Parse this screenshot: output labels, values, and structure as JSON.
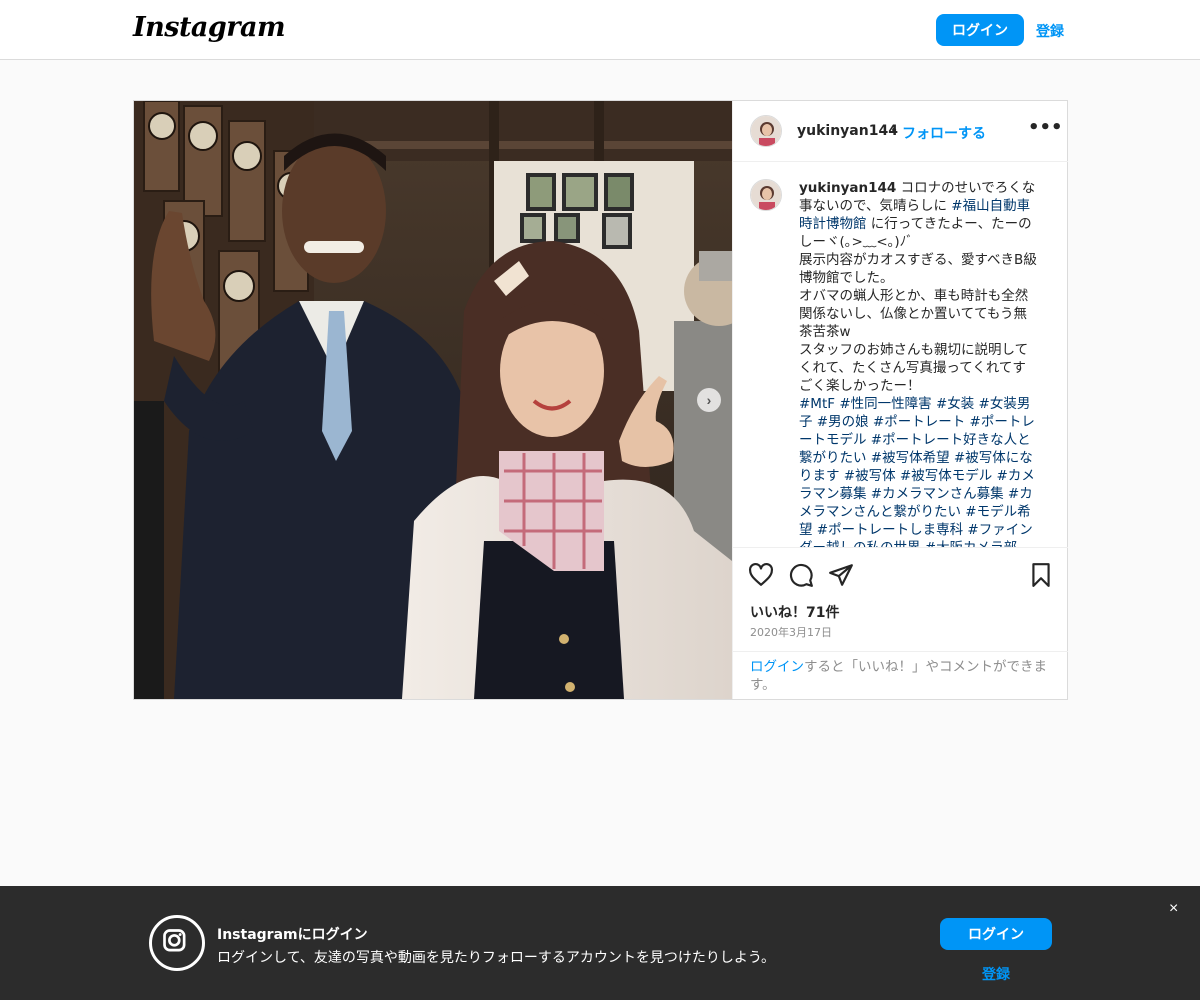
{
  "nav": {
    "logo": "Instagram",
    "login_label": "ログイン",
    "signup_label": "登録"
  },
  "post": {
    "username": "yukinyan144",
    "separator": "•",
    "follow_label": "フォローする",
    "more_label": "•••",
    "next_label": "›",
    "caption": {
      "username": "yukinyan144",
      "segments": [
        {
          "text": " コロナのせいでろくな事ないので、気晴らしに ",
          "tag": false
        },
        {
          "text": "#福山自動車時計博物館",
          "tag": true
        },
        {
          "text": " に行ってきたよー、たーのしーヾ(｡>﹏<｡)ﾉﾞ\n展示内容がカオスすぎる、愛すべきB級博物館でした。\nオバマの蝋人形とか、車も時計も全然関係ないし、仏像とか置いててもう無茶苦茶w\nスタッフのお姉さんも親切に説明してくれて、たくさん写真撮ってくれてすごく楽しかったー！\n",
          "tag": false
        },
        {
          "text": "#MtF",
          "tag": true
        },
        {
          "text": " ",
          "tag": false
        },
        {
          "text": "#性同一性障害",
          "tag": true
        },
        {
          "text": " ",
          "tag": false
        },
        {
          "text": "#女装",
          "tag": true
        },
        {
          "text": " ",
          "tag": false
        },
        {
          "text": "#女装男子",
          "tag": true
        },
        {
          "text": " ",
          "tag": false
        },
        {
          "text": "#男の娘",
          "tag": true
        },
        {
          "text": " ",
          "tag": false
        },
        {
          "text": "#ポートレート",
          "tag": true
        },
        {
          "text": " ",
          "tag": false
        },
        {
          "text": "#ポートレートモデル",
          "tag": true
        },
        {
          "text": " ",
          "tag": false
        },
        {
          "text": "#ポートレート好きな人と繋がりたい",
          "tag": true
        },
        {
          "text": " ",
          "tag": false
        },
        {
          "text": "#被写体希望",
          "tag": true
        },
        {
          "text": " ",
          "tag": false
        },
        {
          "text": "#被写体になります",
          "tag": true
        },
        {
          "text": " ",
          "tag": false
        },
        {
          "text": "#被写体",
          "tag": true
        },
        {
          "text": " ",
          "tag": false
        },
        {
          "text": "#被写体モデル",
          "tag": true
        },
        {
          "text": " ",
          "tag": false
        },
        {
          "text": "#カメラマン募集",
          "tag": true
        },
        {
          "text": " ",
          "tag": false
        },
        {
          "text": "#カメラマンさん募集",
          "tag": true
        },
        {
          "text": " ",
          "tag": false
        },
        {
          "text": "#カメラマンさんと繋がりたい",
          "tag": true
        },
        {
          "text": " ",
          "tag": false
        },
        {
          "text": "#モデル希望",
          "tag": true
        },
        {
          "text": " ",
          "tag": false
        },
        {
          "text": "#ポートレートしま専科",
          "tag": true
        },
        {
          "text": " ",
          "tag": false
        },
        {
          "text": "#ファインダー越しの私の世界",
          "tag": true
        },
        {
          "text": " ",
          "tag": false
        },
        {
          "text": "#大阪カメラ部",
          "tag": true
        }
      ]
    },
    "likes": "いいね！71件",
    "date": "2020年3月17日",
    "login_hint_link": "ログイン",
    "login_hint_text": "すると「いいね！」やコメントができます。",
    "icons": [
      "heart-icon",
      "comment-icon",
      "share-icon",
      "bookmark-icon"
    ]
  },
  "banner": {
    "title": "Instagramにログイン",
    "description": "ログインして、友達の写真や動画を見たりフォローするアカウントを見つけたりしよう。",
    "login_label": "ログイン",
    "signup_label": "登録",
    "close_label": "×"
  },
  "colors": {
    "accent": "#0095f6",
    "hashtag": "#00376b",
    "muted": "#8e8e8e",
    "border": "#dbdbdb",
    "banner_bg": "#2c2c2c"
  }
}
